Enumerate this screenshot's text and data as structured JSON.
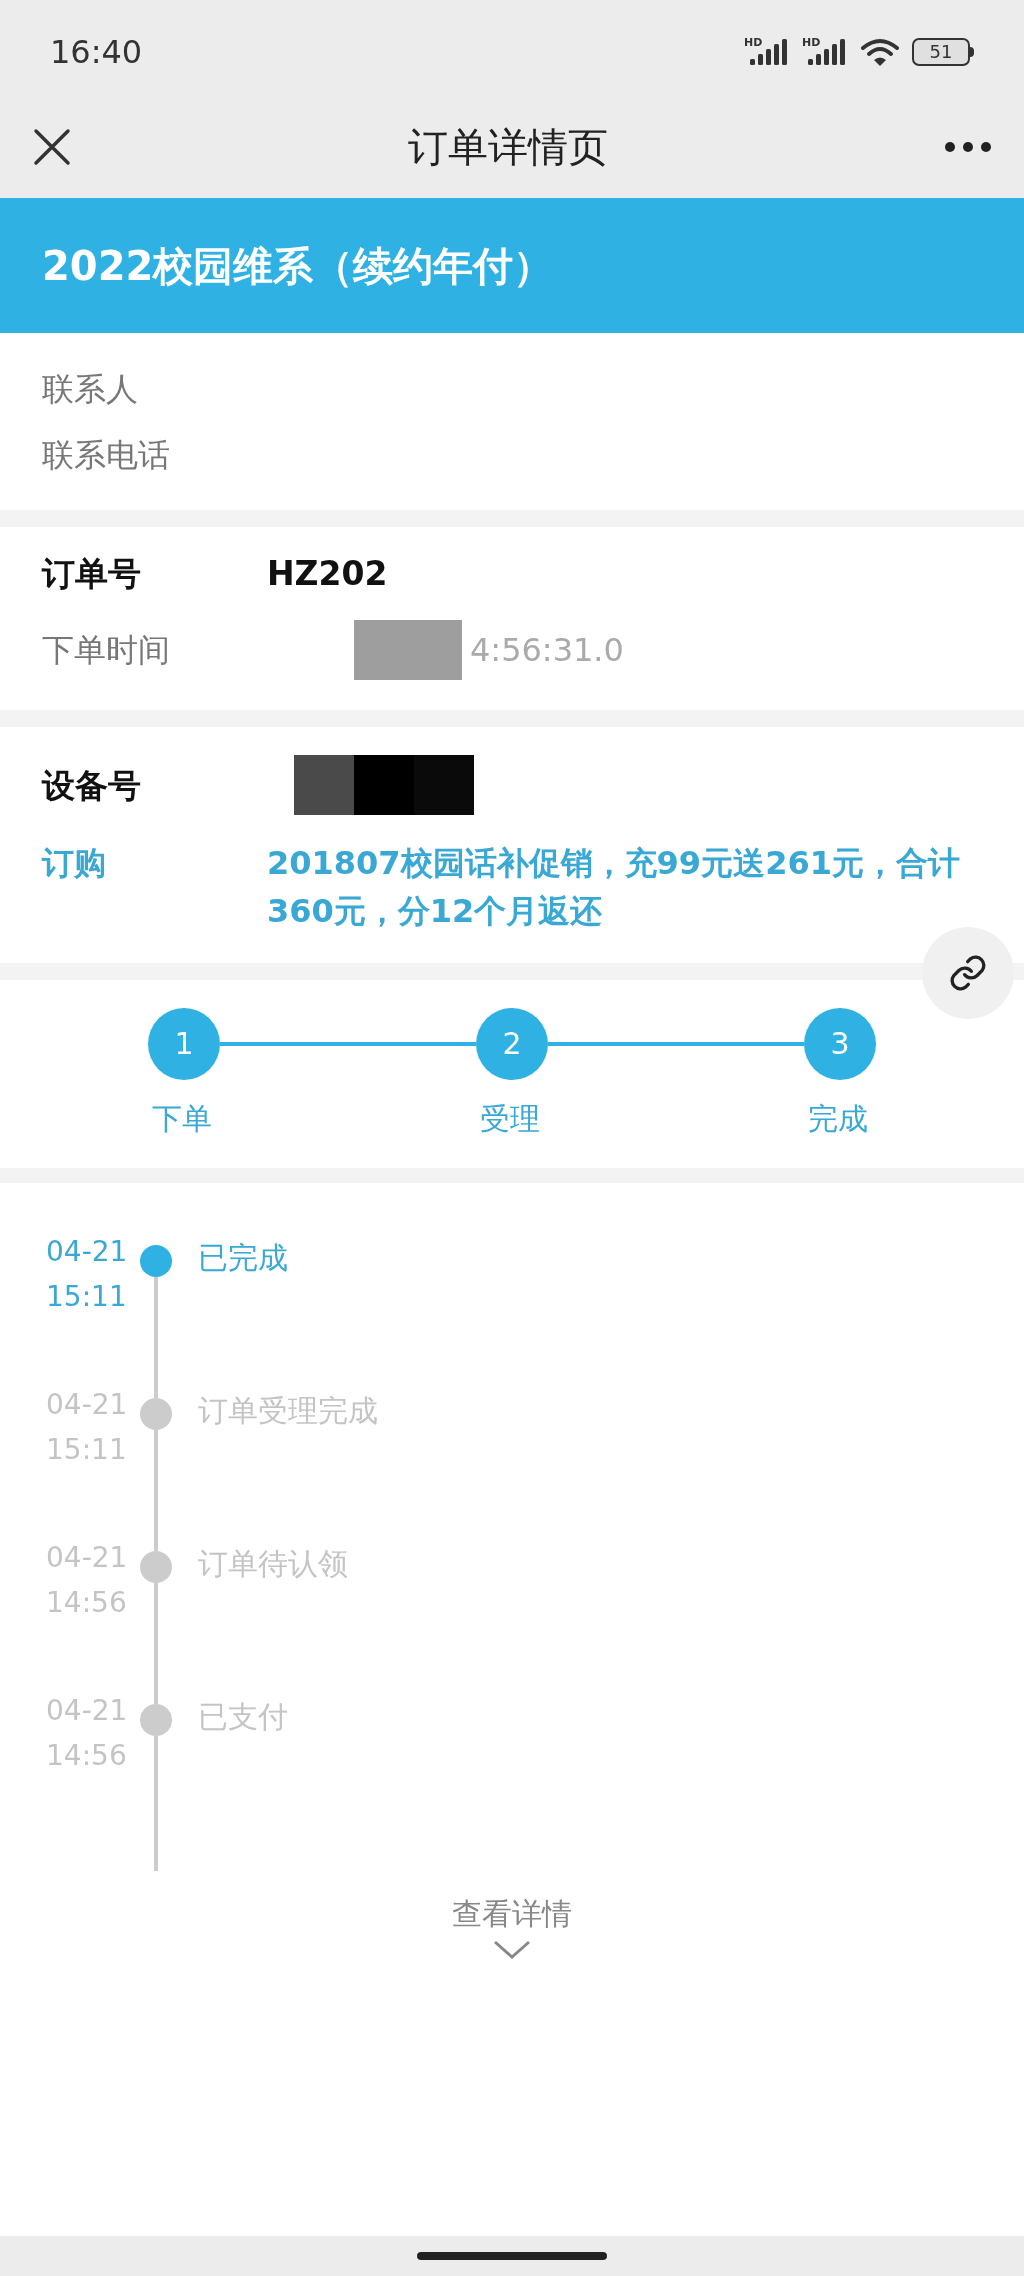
{
  "status_bar": {
    "time": "16:40",
    "signal_labels": [
      "HD",
      "HD"
    ],
    "battery": "51"
  },
  "nav": {
    "title": "订单详情页"
  },
  "header": {
    "title": "2022校园维系（续约年付）"
  },
  "contact": [
    {
      "label": "联系人"
    },
    {
      "label": "联系电话"
    }
  ],
  "order": {
    "number_label": "订单号",
    "number": "HZ202",
    "time_label": "下单时间",
    "time": "4:56:31.0"
  },
  "device": {
    "label": "设备号",
    "purchase_label": "订购",
    "purchase": "201807校园话补促销，充99元送261元，合计360元，分12个月返还"
  },
  "steps": [
    {
      "number": "1",
      "label": "下单",
      "done": true
    },
    {
      "number": "2",
      "label": "受理",
      "done": true
    },
    {
      "number": "3",
      "label": "完成",
      "done": true
    }
  ],
  "timeline": [
    {
      "date": "04-21",
      "time": "15:11",
      "status": "已完成",
      "current": true
    },
    {
      "date": "04-21",
      "time": "15:11",
      "status": "订单受理完成",
      "current": false
    },
    {
      "date": "04-21",
      "time": "14:56",
      "status": "订单待认领",
      "current": false
    },
    {
      "date": "04-21",
      "time": "14:56",
      "status": "已支付",
      "current": false
    }
  ],
  "details_link": "查看详情"
}
